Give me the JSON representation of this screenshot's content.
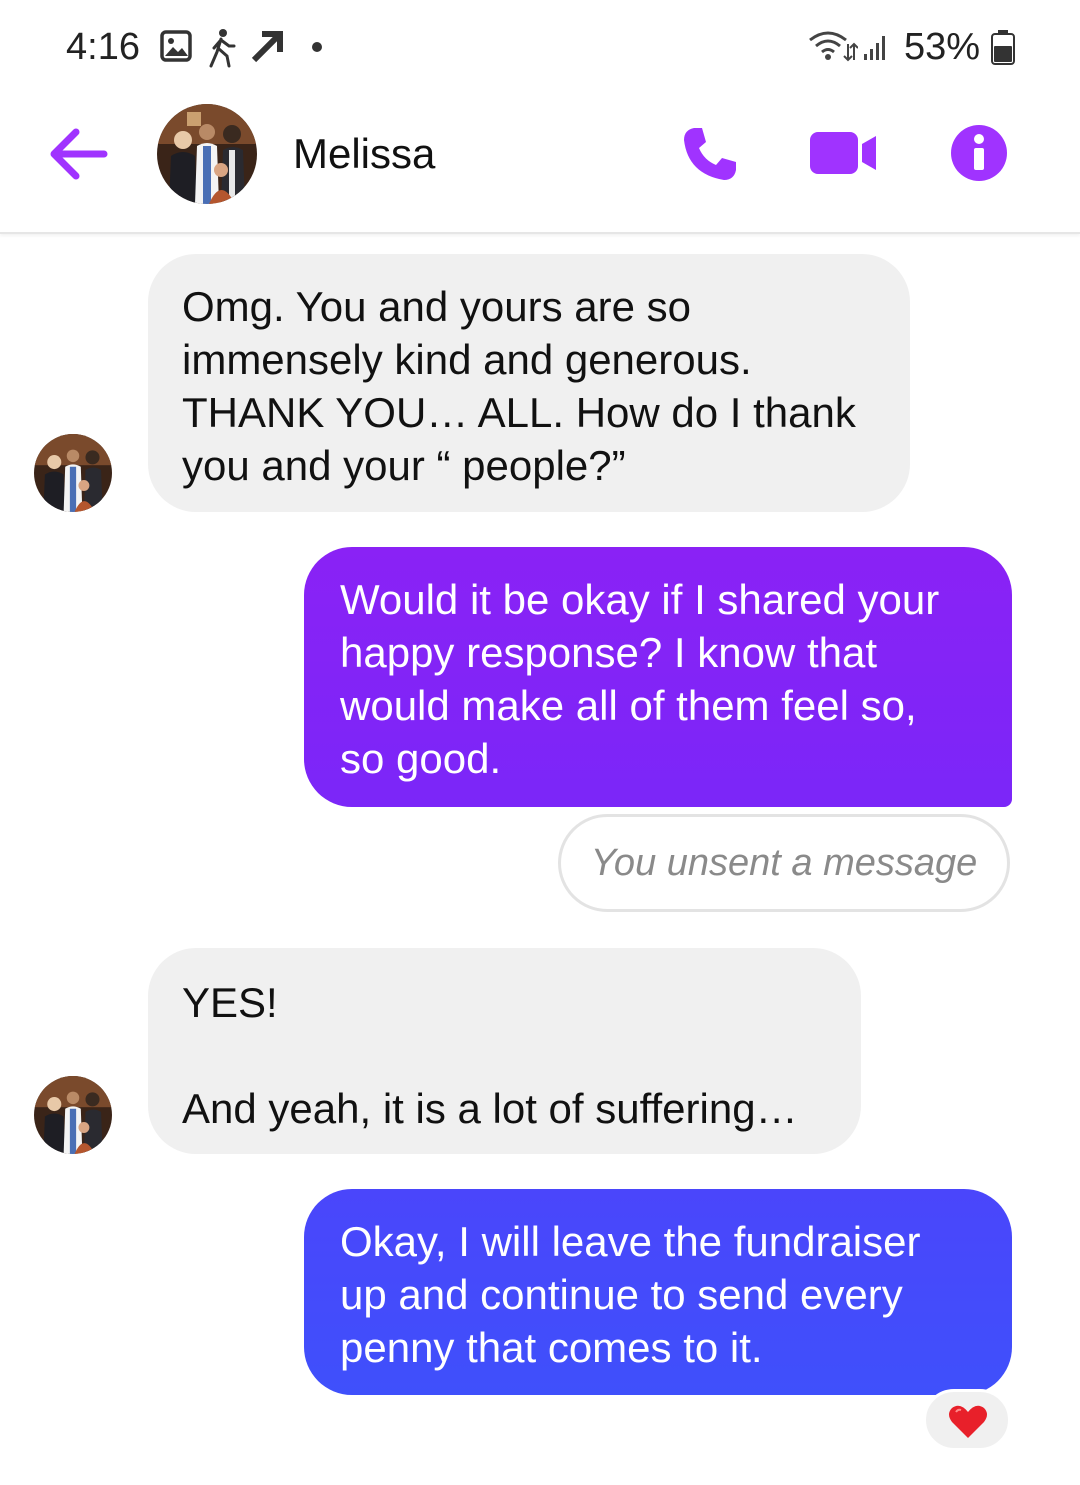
{
  "status_bar": {
    "time": "4:16",
    "battery": "53%",
    "icons": [
      "gallery-icon",
      "walk-icon",
      "trending-icon",
      "dot-icon",
      "wifi-icon",
      "signal-icon",
      "battery-icon"
    ]
  },
  "header": {
    "contact_name": "Melissa",
    "icons": [
      "back-arrow-icon",
      "phone-icon",
      "video-icon",
      "info-icon"
    ],
    "accent_color": "#a033ff"
  },
  "messages": [
    {
      "from": "contact",
      "text": "Omg. You and yours are so\nimmensely kind and generous.\nTHANK YOU… ALL. How do I thank\nyou and your “ people?”"
    },
    {
      "from": "me",
      "text": "Would it be okay if I shared your\nhappy response? I know that\nwould make all of them feel so,\nso good."
    },
    {
      "from": "system",
      "text": "You unsent a message"
    },
    {
      "from": "contact",
      "text": "YES!\n\nAnd yeah, it is a lot of suffering…"
    },
    {
      "from": "me",
      "text": "Okay, I will leave the fundraiser\nup and continue to send every\npenny that comes to it.",
      "reaction": "heart-icon"
    }
  ],
  "colors": {
    "bubble_out_top": "#8a22f5",
    "bubble_out_bottom": "#4350fb",
    "bubble_in": "#f0f0f0",
    "reaction_heart": "#e8202a"
  }
}
